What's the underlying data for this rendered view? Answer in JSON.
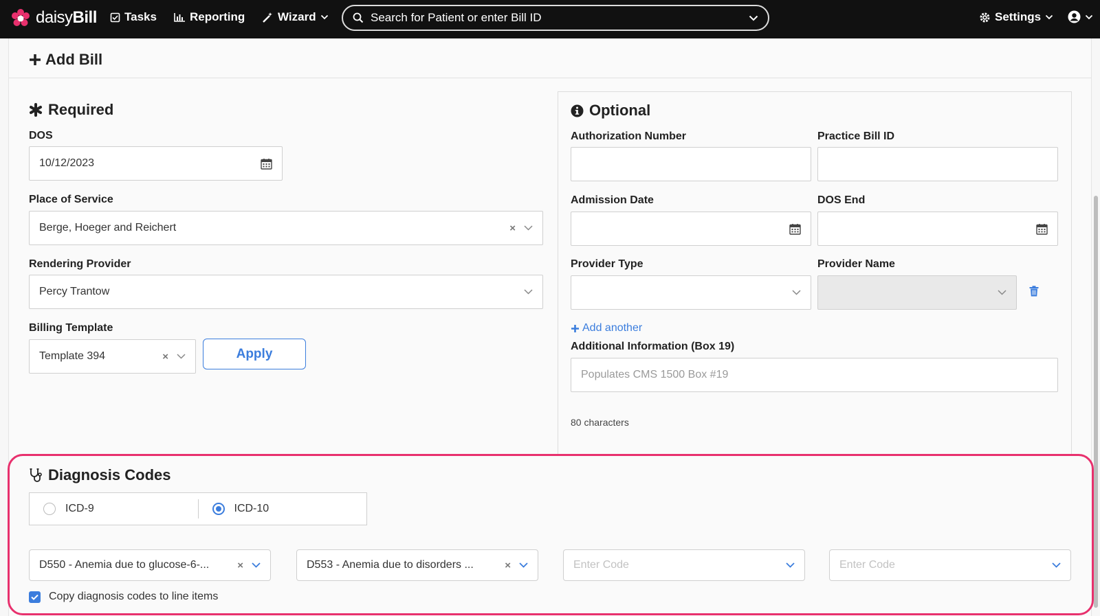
{
  "nav": {
    "brand_prefix": "daisy",
    "brand_suffix": "Bill",
    "tasks": "Tasks",
    "reporting": "Reporting",
    "wizard": "Wizard",
    "search_placeholder": "Search for Patient or enter Bill ID",
    "settings": "Settings",
    "accent": "#e8306d"
  },
  "page": {
    "title": "Add Bill"
  },
  "required": {
    "title": "Required",
    "dos_label": "DOS",
    "dos_value": "10/12/2023",
    "place_label": "Place of Service",
    "place_value": "Berge, Hoeger and Reichert",
    "provider_label": "Rendering Provider",
    "provider_value": "Percy Trantow",
    "template_label": "Billing Template",
    "template_value": "Template 394",
    "apply_label": "Apply"
  },
  "optional": {
    "title": "Optional",
    "auth_label": "Authorization Number",
    "auth_value": "",
    "practice_label": "Practice Bill ID",
    "practice_value": "",
    "admission_label": "Admission Date",
    "admission_value": "",
    "dos_end_label": "DOS End",
    "dos_end_value": "",
    "provider_type_label": "Provider Type",
    "provider_type_value": "",
    "provider_name_label": "Provider Name",
    "provider_name_value": "",
    "add_another": "Add another",
    "additional_label": "Additional Information (Box 19)",
    "additional_placeholder": "Populates CMS 1500 Box #19",
    "char_count": "80 characters"
  },
  "diagnosis": {
    "title": "Diagnosis Codes",
    "icd9": "ICD-9",
    "icd10": "ICD-10",
    "selected": "ICD-10",
    "codes": [
      {
        "value": "D550 - Anemia due to glucose-6-..."
      },
      {
        "value": "D553 - Anemia due to disorders ..."
      },
      {
        "placeholder": "Enter Code"
      },
      {
        "placeholder": "Enter Code"
      }
    ],
    "copy_label": "Copy diagnosis codes to line items",
    "copy_checked": true,
    "highlight_color": "#e8306d"
  },
  "colors": {
    "primary": "#3b7ddd",
    "navbar": "#111111"
  }
}
